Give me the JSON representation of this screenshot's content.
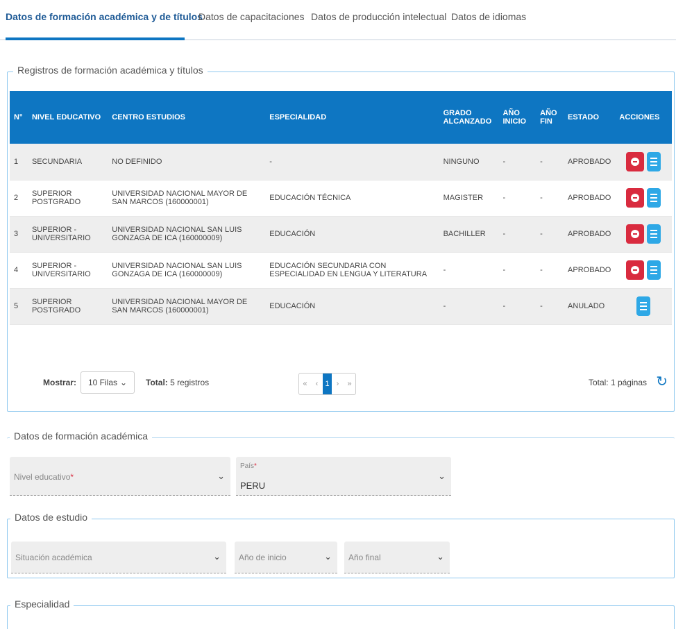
{
  "tabs": [
    {
      "label": "Datos de formación académica y de títulos"
    },
    {
      "label": "Datos de capacitaciones"
    },
    {
      "label": "Datos de producción intelectual"
    },
    {
      "label": "Datos de idiomas"
    }
  ],
  "registros": {
    "legend": "Registros de formación académica y títulos",
    "headers": {
      "num": "N°",
      "nivel": "NIVEL EDUCATIVO",
      "centro": "CENTRO ESTUDIOS",
      "especialidad": "ESPECIALIDAD",
      "grado": "GRADO ALCANZADO",
      "inicio": "AÑO INICIO",
      "fin": "AÑO FIN",
      "estado": "ESTADO",
      "acciones": "ACCIONES"
    },
    "rows": [
      {
        "num": "1",
        "nivel": "SECUNDARIA",
        "centro": "NO DEFINIDO",
        "especialidad": "-",
        "grado": "NINGUNO",
        "inicio": "-",
        "fin": "-",
        "estado": "APROBADO"
      },
      {
        "num": "2",
        "nivel": "SUPERIOR POSTGRADO",
        "centro": "UNIVERSIDAD NACIONAL MAYOR DE SAN MARCOS (160000001)",
        "especialidad": "EDUCACIÓN TÉCNICA",
        "grado": "MAGISTER",
        "inicio": "-",
        "fin": "-",
        "estado": "APROBADO"
      },
      {
        "num": "3",
        "nivel": "SUPERIOR - UNIVERSITARIO",
        "centro": "UNIVERSIDAD NACIONAL SAN LUIS GONZAGA DE ICA (160000009)",
        "especialidad": "EDUCACIÓN",
        "grado": "BACHILLER",
        "inicio": "-",
        "fin": "-",
        "estado": "APROBADO"
      },
      {
        "num": "4",
        "nivel": "SUPERIOR - UNIVERSITARIO",
        "centro": "UNIVERSIDAD NACIONAL SAN LUIS GONZAGA DE ICA (160000009)",
        "especialidad": "EDUCACIÓN SECUNDARIA CON ESPECIALIDAD EN LENGUA Y LITERATURA",
        "grado": "-",
        "inicio": "-",
        "fin": "-",
        "estado": "APROBADO"
      },
      {
        "num": "5",
        "nivel": "SUPERIOR POSTGRADO",
        "centro": "UNIVERSIDAD NACIONAL MAYOR DE SAN MARCOS (160000001)",
        "especialidad": "EDUCACIÓN",
        "grado": "-",
        "inicio": "-",
        "fin": "-",
        "estado": "ANULADO"
      }
    ],
    "pagination": {
      "mostrar_label": "Mostrar:",
      "rows_value": "10 Filas",
      "total_label": "Total:",
      "total_value": "5 registros",
      "current_page": "1",
      "first": "«",
      "prev": "‹",
      "next": "›",
      "last": "»",
      "pages_text": "Total: 1 páginas"
    }
  },
  "formacion": {
    "legend": "Datos de formación académica",
    "nivel_label": "Nivel educativo",
    "pais_label": "País",
    "pais_value": "PERU"
  },
  "estudio": {
    "legend": "Datos de estudio",
    "situacion_label": "Situación académica",
    "inicio_label": "Año de inicio",
    "final_label": "Año final"
  },
  "especialidad": {
    "legend": "Especialidad"
  },
  "colors": {
    "accent": "#0e76c2",
    "delete": "#d92b3f",
    "view": "#2ea8e6"
  }
}
